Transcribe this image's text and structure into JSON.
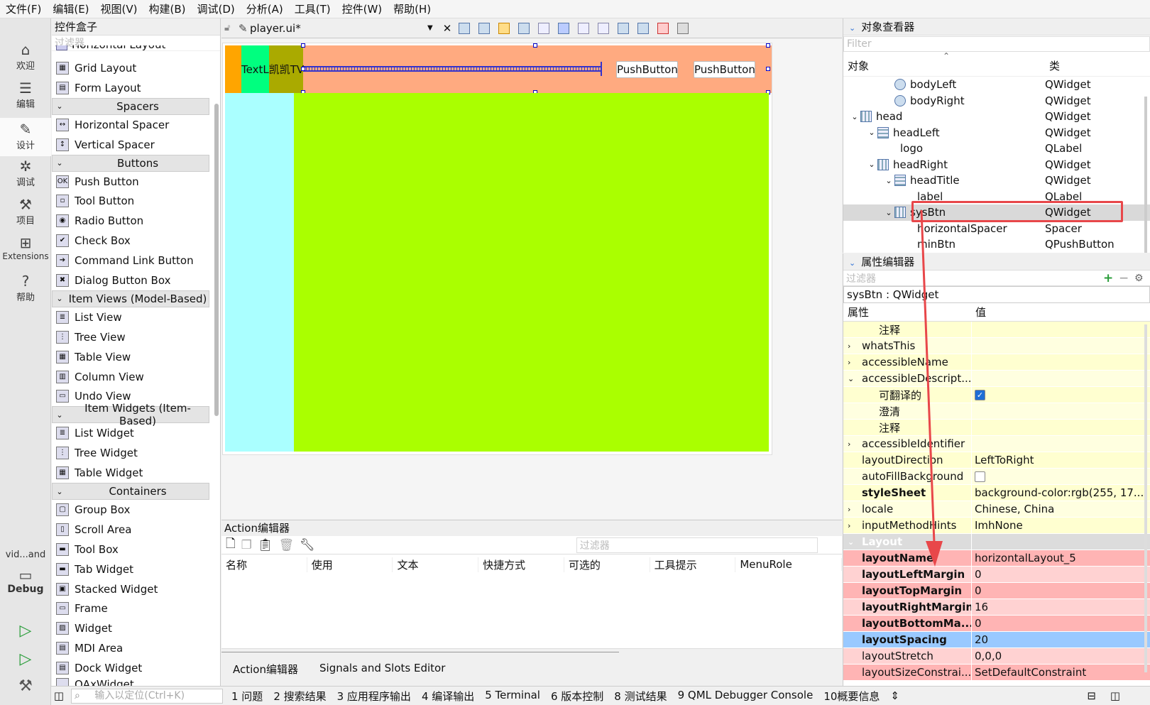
{
  "menu": [
    "文件(F)",
    "编辑(E)",
    "视图(V)",
    "构建(B)",
    "调试(D)",
    "分析(A)",
    "工具(T)",
    "控件(W)",
    "帮助(H)"
  ],
  "leftbar": {
    "items": [
      "欢迎",
      "编辑",
      "设计",
      "调试",
      "项目",
      "Extensions",
      "帮助"
    ],
    "kit": "vid...and",
    "debug": "Debug"
  },
  "widgetbox": {
    "title": "控件盒子",
    "filter_placeholder": "过滤器",
    "partial_top": "Horizontal Layout",
    "rows": [
      {
        "type": "item",
        "label": "Grid Layout",
        "icon": "grid-layout-icon"
      },
      {
        "type": "item",
        "label": "Form Layout",
        "icon": "form-layout-icon"
      },
      {
        "type": "cat",
        "label": "Spacers"
      },
      {
        "type": "item",
        "label": "Horizontal Spacer",
        "icon": "horizontal-spacer-icon"
      },
      {
        "type": "item",
        "label": "Vertical Spacer",
        "icon": "vertical-spacer-icon"
      },
      {
        "type": "cat",
        "label": "Buttons"
      },
      {
        "type": "item",
        "label": "Push Button",
        "icon": "push-button-icon"
      },
      {
        "type": "item",
        "label": "Tool Button",
        "icon": "tool-button-icon"
      },
      {
        "type": "item",
        "label": "Radio Button",
        "icon": "radio-button-icon"
      },
      {
        "type": "item",
        "label": "Check Box",
        "icon": "check-box-icon"
      },
      {
        "type": "item",
        "label": "Command Link Button",
        "icon": "command-link-icon"
      },
      {
        "type": "item",
        "label": "Dialog Button Box",
        "icon": "dialog-button-box-icon"
      },
      {
        "type": "cat",
        "label": "Item Views (Model-Based)"
      },
      {
        "type": "item",
        "label": "List View",
        "icon": "list-view-icon"
      },
      {
        "type": "item",
        "label": "Tree View",
        "icon": "tree-view-icon"
      },
      {
        "type": "item",
        "label": "Table View",
        "icon": "table-view-icon"
      },
      {
        "type": "item",
        "label": "Column View",
        "icon": "column-view-icon"
      },
      {
        "type": "item",
        "label": "Undo View",
        "icon": "undo-view-icon"
      },
      {
        "type": "cat",
        "label": "Item Widgets (Item-Based)"
      },
      {
        "type": "item",
        "label": "List Widget",
        "icon": "list-widget-icon"
      },
      {
        "type": "item",
        "label": "Tree Widget",
        "icon": "tree-widget-icon"
      },
      {
        "type": "item",
        "label": "Table Widget",
        "icon": "table-widget-icon"
      },
      {
        "type": "cat",
        "label": "Containers"
      },
      {
        "type": "item",
        "label": "Group Box",
        "icon": "group-box-icon"
      },
      {
        "type": "item",
        "label": "Scroll Area",
        "icon": "scroll-area-icon"
      },
      {
        "type": "item",
        "label": "Tool Box",
        "icon": "tool-box-icon"
      },
      {
        "type": "item",
        "label": "Tab Widget",
        "icon": "tab-widget-icon"
      },
      {
        "type": "item",
        "label": "Stacked Widget",
        "icon": "stacked-widget-icon"
      },
      {
        "type": "item",
        "label": "Frame",
        "icon": "frame-icon"
      },
      {
        "type": "item",
        "label": "Widget",
        "icon": "widget-icon"
      },
      {
        "type": "item",
        "label": "MDI Area",
        "icon": "mdi-area-icon"
      },
      {
        "type": "item",
        "label": "Dock Widget",
        "icon": "dock-widget-icon"
      }
    ],
    "partial_bottom": "QAxWidget"
  },
  "editor": {
    "file": "player.ui*",
    "label_text": "TextL凯凯TV",
    "push_button_1": "PushButton",
    "push_button_2": "PushButton",
    "colors": {
      "orange": "#ffa500",
      "green": "#00ff7f",
      "olive": "#aaaa00",
      "salmon": "#ffaa80",
      "cyan": "#aaffff",
      "lime": "#aaff00"
    }
  },
  "action_editor": {
    "title": "Action编辑器",
    "filter_placeholder": "过滤器",
    "columns": [
      "名称",
      "使用",
      "文本",
      "快捷方式",
      "可选的",
      "工具提示",
      "MenuRole"
    ],
    "tabs": [
      "Action编辑器",
      "Signals and Slots Editor"
    ]
  },
  "object_viewer": {
    "title": "对象查看器",
    "filter_placeholder": "Filter",
    "col_object": "对象",
    "col_class": "类",
    "rows": [
      {
        "indent": 4,
        "name": "bodyLeft",
        "cls": "QWidget",
        "arrow": "",
        "icon": "widget-blocked-icon"
      },
      {
        "indent": 4,
        "name": "bodyRight",
        "cls": "QWidget",
        "arrow": "",
        "icon": "widget-blocked-icon"
      },
      {
        "indent": 2,
        "name": "head",
        "cls": "QWidget",
        "arrow": "v",
        "icon": "hlayout-icon"
      },
      {
        "indent": 3,
        "name": "headLeft",
        "cls": "QWidget",
        "arrow": "v",
        "icon": "vlayout-icon"
      },
      {
        "indent": 4,
        "name": "logo",
        "cls": "QLabel",
        "arrow": "",
        "icon": ""
      },
      {
        "indent": 3,
        "name": "headRight",
        "cls": "QWidget",
        "arrow": "v",
        "icon": "hlayout-icon"
      },
      {
        "indent": 4,
        "name": "headTitle",
        "cls": "QWidget",
        "arrow": "v",
        "icon": "vlayout-icon"
      },
      {
        "indent": 5,
        "name": "label",
        "cls": "QLabel",
        "arrow": "",
        "icon": ""
      },
      {
        "indent": 4,
        "name": "sysBtn",
        "cls": "QWidget",
        "arrow": "v",
        "icon": "hlayout-icon",
        "selected": true
      },
      {
        "indent": 5,
        "name": "horizontalSpacer",
        "cls": "Spacer",
        "arrow": "",
        "icon": ""
      },
      {
        "indent": 5,
        "name": "minBtn",
        "cls": "QPushButton",
        "arrow": "",
        "icon": ""
      }
    ]
  },
  "property_editor": {
    "title": "属性编辑器",
    "filter_placeholder": "过滤器",
    "object_label": "sysBtn : QWidget",
    "col_property": "属性",
    "col_value": "值",
    "rows": [
      {
        "name": "注释",
        "value": "",
        "indent": 2,
        "bg": "#ffffd0"
      },
      {
        "name": "whatsThis",
        "value": "",
        "indent": 1,
        "arrow": ">",
        "bg": "#ffffe0"
      },
      {
        "name": "accessibleName",
        "value": "",
        "indent": 1,
        "arrow": ">",
        "bg": "#ffffd0"
      },
      {
        "name": "accessibleDescript...",
        "value": "",
        "indent": 1,
        "arrow": "v",
        "bg": "#ffffe0"
      },
      {
        "name": "可翻译的",
        "value": "",
        "indent": 2,
        "bg": "#ffffd0",
        "check": true
      },
      {
        "name": "澄清",
        "value": "",
        "indent": 2,
        "bg": "#ffffe0"
      },
      {
        "name": "注释",
        "value": "",
        "indent": 2,
        "bg": "#ffffd0"
      },
      {
        "name": "accessibleIdentifier",
        "value": "",
        "indent": 1,
        "arrow": ">",
        "bg": "#ffffe0"
      },
      {
        "name": "layoutDirection",
        "value": "LeftToRight",
        "indent": 1,
        "bg": "#ffffd0"
      },
      {
        "name": "autoFillBackground",
        "value": "",
        "indent": 1,
        "bg": "#ffffe0",
        "check": false
      },
      {
        "name": "styleSheet",
        "value": "background-color:rgb(255, 17...",
        "indent": 1,
        "bg": "#ffffd0",
        "bold": true
      },
      {
        "name": "locale",
        "value": "Chinese, China",
        "indent": 1,
        "arrow": ">",
        "bg": "#ffffe0"
      },
      {
        "name": "inputMethodHints",
        "value": "ImhNone",
        "indent": 1,
        "arrow": ">",
        "bg": "#ffffd0"
      },
      {
        "name": "Layout",
        "value": "",
        "indent": 1,
        "arrow": "v",
        "bg": "#dcdcdc",
        "section": true
      },
      {
        "name": "layoutName",
        "value": "horizontalLayout_5",
        "indent": 1,
        "bg": "#ffb4b4",
        "bold": true
      },
      {
        "name": "layoutLeftMargin",
        "value": "0",
        "indent": 1,
        "bg": "#ffd2d2",
        "bold": true
      },
      {
        "name": "layoutTopMargin",
        "value": "0",
        "indent": 1,
        "bg": "#ffb4b4",
        "bold": true
      },
      {
        "name": "layoutRightMargin",
        "value": "16",
        "indent": 1,
        "bg": "#ffd2d2",
        "bold": true
      },
      {
        "name": "layoutBottomMa...",
        "value": "0",
        "indent": 1,
        "bg": "#ffb4b4",
        "bold": true
      },
      {
        "name": "layoutSpacing",
        "value": "20",
        "indent": 1,
        "bg": "#99c9ff",
        "bold": true
      },
      {
        "name": "layoutStretch",
        "value": "0,0,0",
        "indent": 1,
        "bg": "#ffd2d2"
      },
      {
        "name": "layoutSizeConstrai...",
        "value": "SetDefaultConstraint",
        "indent": 1,
        "bg": "#ffb4b4"
      }
    ]
  },
  "statusbar": {
    "search_placeholder": "输入以定位(Ctrl+K)",
    "items": [
      "1 问题",
      "2 搜索结果",
      "3 应用程序输出",
      "4 编译输出",
      "5 Terminal",
      "6 版本控制",
      "8 测试结果",
      "9 QML Debugger Console",
      "10概要信息"
    ]
  }
}
